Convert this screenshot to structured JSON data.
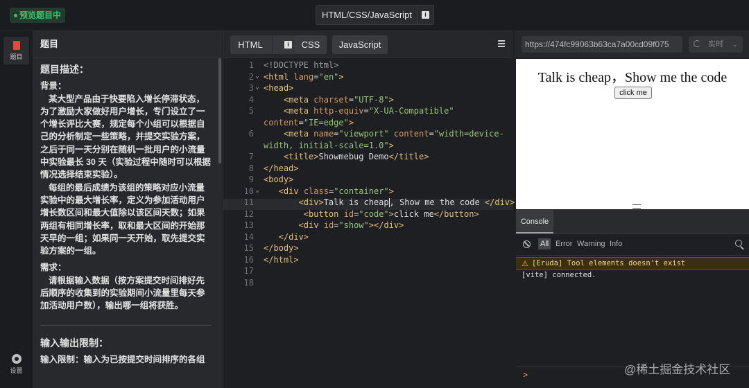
{
  "topbar": {
    "status_badge": "预览题目中",
    "mode_label": "HTML/CSS/JavaScript"
  },
  "leftnav": {
    "problem_label": "题目",
    "settings_label": "设置"
  },
  "problem": {
    "header": "题目",
    "desc_title": "题目描述：",
    "bg_label": "背景：",
    "bg_text": "某大型产品由于快要陷入增长停滞状态，为了激励大家做好用户增长，专门设立了一个增长评比大赛，规定每个小组可以根据自己的分析制定一些策略，并提交实验方案，之后于同一天分别在随机一批用户的小流量中实验最长 30 天（实验过程中随时可以根据情况选择结束实验）。",
    "rule_text": "每组的最后成绩为该组的策略对应小流量实验中的最大增长率，定义为参加活动用户增长数区间和最大值除以该区间天数；如果两组有相同增长率，取和最大区间的开始那天早的一组；如果同一天开始，取先提交实验方案的一组。",
    "req_label": "需求：",
    "req_text": "请根据输入数据（按方案提交时间排好先后顺序的收集到的实验期间小流量里每天参加活动用户数），输出哪一组将获胜。",
    "io_title": "输入输出限制：",
    "io_text": "输入限制：输入为已按提交时间排序的各组"
  },
  "editor": {
    "tabs": [
      "HTML",
      "CSS",
      "JavaScript"
    ],
    "line_numbers": [
      "1",
      "2",
      "3",
      "4",
      "5",
      "6",
      "",
      "7",
      "8",
      "9",
      "10",
      "11",
      "12",
      "13",
      "14",
      "15",
      "16",
      "17",
      "18"
    ]
  },
  "preview": {
    "url": "https://474fc99063b63ca7a00cd09f075",
    "refresh_mode": "实时",
    "heading": "Talk is cheap，Show me the code",
    "button": "click me"
  },
  "console": {
    "tab": "Console",
    "filters": [
      "All",
      "Error",
      "Warning",
      "Info"
    ],
    "warning": "[Eruda] Tool elements doesn't exist",
    "log": "[vite] connected.",
    "prompt": ">"
  },
  "watermark": "@稀土掘金技术社区",
  "colors": {
    "badge_green": "#39c46a",
    "code_tag": "#e5c07b",
    "code_attr": "#d19a66",
    "code_string": "#98c379",
    "warning_bg": "#3a2f12"
  }
}
